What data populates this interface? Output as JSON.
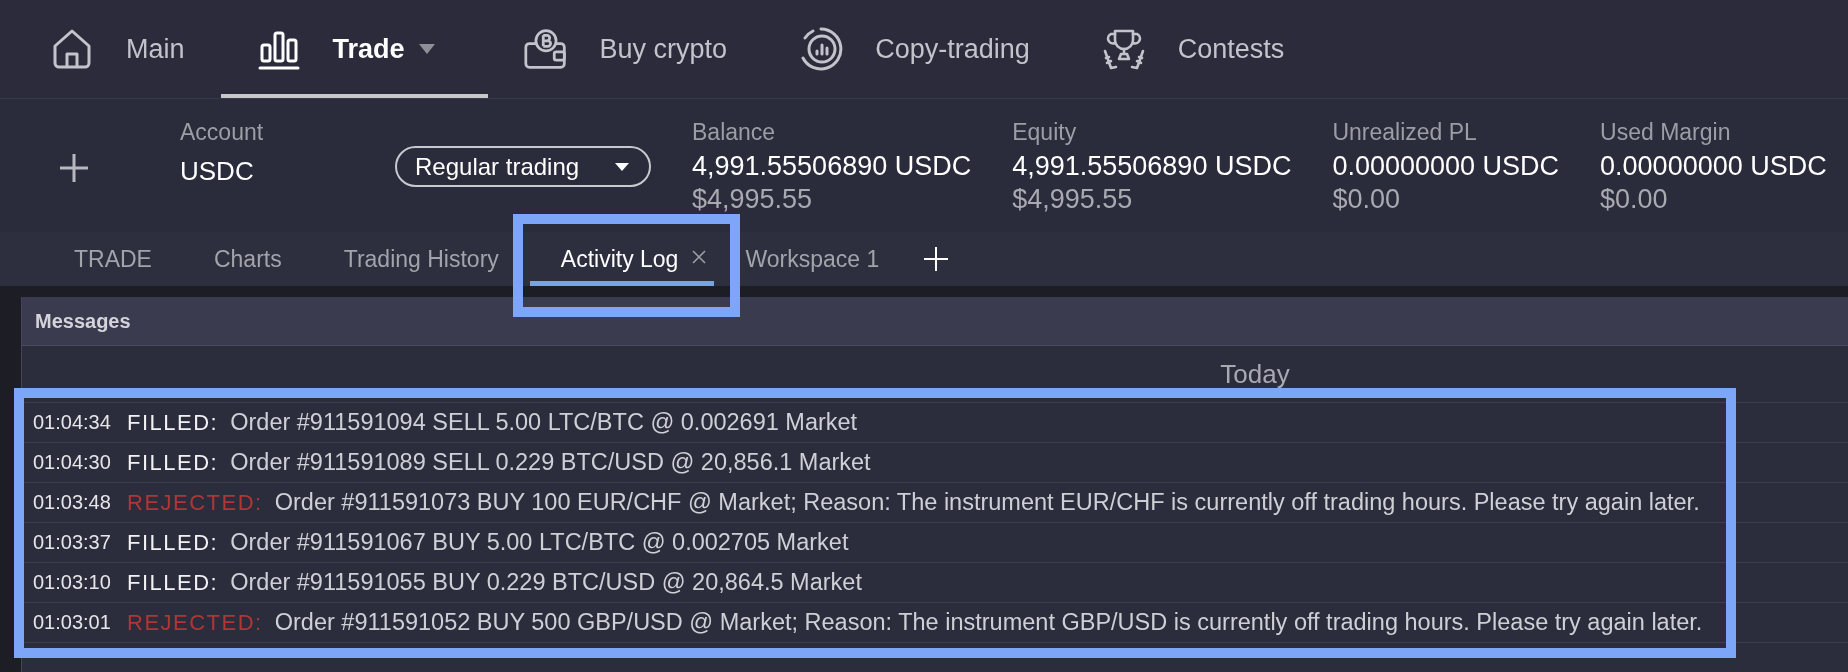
{
  "nav": {
    "items": [
      {
        "label": "Main",
        "selected": false,
        "has_menu": false
      },
      {
        "label": "Trade",
        "selected": true,
        "has_menu": true
      },
      {
        "label": "Buy crypto",
        "selected": false,
        "has_menu": false
      },
      {
        "label": "Copy-trading",
        "selected": false,
        "has_menu": false
      },
      {
        "label": "Contests",
        "selected": false,
        "has_menu": false
      }
    ]
  },
  "account_bar": {
    "account": {
      "label": "Account",
      "value": "USDC"
    },
    "mode_select": {
      "value": "Regular trading"
    },
    "metrics": [
      {
        "label": "Balance",
        "value": "4,991.55506890 USDC",
        "usd_value": "$4,995.55"
      },
      {
        "label": "Equity",
        "value": "4,991.55506890 USDC",
        "usd_value": "$4,995.55"
      },
      {
        "label": "Unrealized PL",
        "value": "0.00000000 USDC",
        "usd_value": "$0.00"
      },
      {
        "label": "Used Margin",
        "value": "0.00000000 USDC",
        "usd_value": "$0.00"
      }
    ]
  },
  "tabs": [
    {
      "label": "TRADE",
      "selected": false,
      "closable": false,
      "highlighted": false
    },
    {
      "label": "Charts",
      "selected": false,
      "closable": false,
      "highlighted": false
    },
    {
      "label": "Trading History",
      "selected": false,
      "closable": false,
      "highlighted": false
    },
    {
      "label": "Activity Log",
      "selected": true,
      "closable": true,
      "highlighted": true
    },
    {
      "label": "Workspace 1",
      "selected": false,
      "closable": false,
      "highlighted": false
    }
  ],
  "messages": {
    "title": "Messages",
    "date": "Today",
    "highlighted": true,
    "rows": [
      {
        "time": "01:04:34",
        "kind": "filled",
        "status": "FILLED:",
        "text": "Order #911591094 SELL 5.00 LTC/BTC @ 0.002691 Market"
      },
      {
        "time": "01:04:30",
        "kind": "filled",
        "status": "FILLED:",
        "text": "Order #911591089 SELL 0.229 BTC/USD @ 20,856.1 Market"
      },
      {
        "time": "01:03:48",
        "kind": "rejected",
        "status": "REJECTED:",
        "text": "Order #911591073 BUY 100 EUR/CHF @ Market; Reason: The instrument EUR/CHF is currently off trading hours. Please try again later."
      },
      {
        "time": "01:03:37",
        "kind": "filled",
        "status": "FILLED:",
        "text": "Order #911591067 BUY 5.00 LTC/BTC @ 0.002705 Market"
      },
      {
        "time": "01:03:10",
        "kind": "filled",
        "status": "FILLED:",
        "text": "Order #911591055 BUY 0.229 BTC/USD @ 20,864.5 Market"
      },
      {
        "time": "01:03:01",
        "kind": "rejected",
        "status": "REJECTED:",
        "text": "Order #911591052 BUY 500 GBP/USD @ Market; Reason: The instrument GBP/USD is currently off trading hours. Please try again later."
      }
    ]
  }
}
